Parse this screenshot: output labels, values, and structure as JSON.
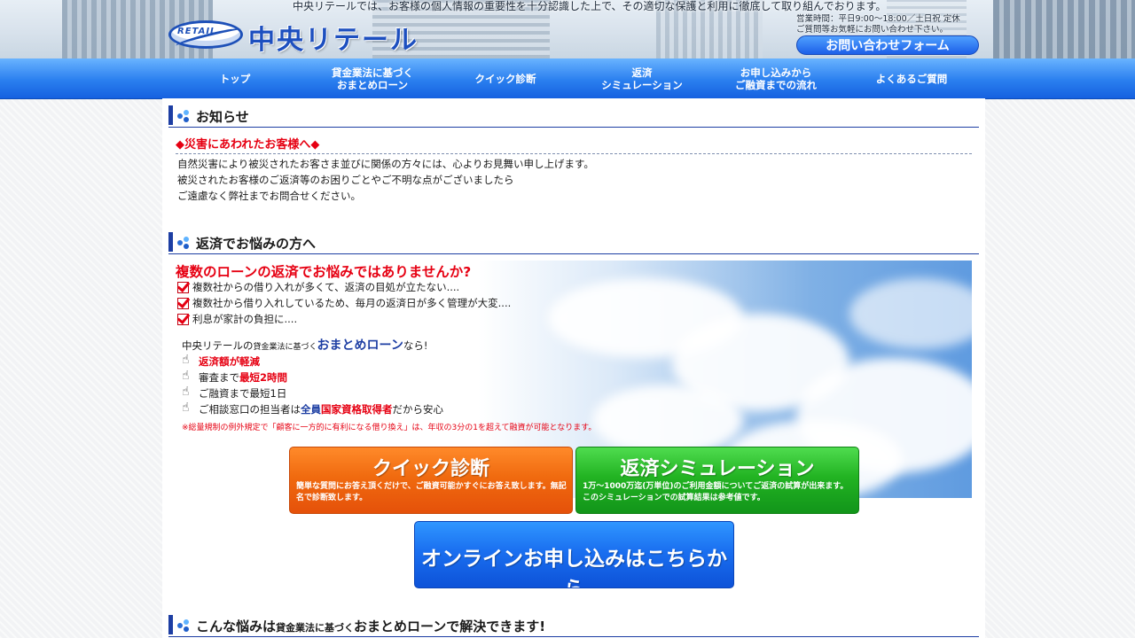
{
  "header": {
    "tagline": "中央リテールでは、お客様の個人情報の重要性を十分認識した上で、その適切な保護と利用に徹底して取り組んでおります。",
    "logo_text": "RETAIL",
    "brand_name": "中央リテール",
    "hours_line1": "営業時間：平日9:00〜18:00／土日祝 定休",
    "hours_line2": "ご質問等お気軽にお問い合わせ下さい。",
    "contact_button": "お問い合わせフォーム"
  },
  "nav": {
    "items": [
      {
        "label": "トップ"
      },
      {
        "label": "貸金業法に基づく\nおまとめローン"
      },
      {
        "label": "クイック診断"
      },
      {
        "label": "返済\nシミュレーション"
      },
      {
        "label": "お申し込みから\nご融資までの流れ"
      },
      {
        "label": "よくあるご質問"
      }
    ]
  },
  "news": {
    "heading": "お知らせ",
    "notice_title": "◆災害にあわれたお客様へ◆",
    "lines": [
      "自然災害により被災されたお客さま並びに関係の方々には、心よりお見舞い申し上げます。",
      "被災されたお客様のご返済等のお困りごとやご不明な点がございましたら",
      "ご遠慮なく弊社までお問合せください。"
    ]
  },
  "worry": {
    "heading": "返済でお悩みの方へ",
    "headline": "複数のローンの返済でお悩みではありませんか?",
    "checks": [
      "複数社からの借り入れが多くて、返済の目処が立たない....",
      "複数社から借り入れしているため、毎月の返済日が多く管理が大変....",
      "利息が家計の負担に...."
    ],
    "intro_prefix": "中央リテールの",
    "intro_small": "貸金業法に基づく",
    "intro_big": "おまとめローン",
    "intro_suffix": "なら!",
    "point1": "返済額が軽減",
    "point2_prefix": "審査まで",
    "point2_red": "最短2時間",
    "point3": "ご融資まで最短1日",
    "point4_prefix": "ご相談窓口の担当者は",
    "point4_blue": "全員",
    "point4_red": "国家資格取得者",
    "point4_suffix": "だから安心",
    "footnote": "※総量規制の例外規定で「顧客に一方的に有利になる借り換え」は、年収の3分の1を超えて融資が可能となります。"
  },
  "cta": {
    "quick_title": "クイック診断",
    "quick_desc": "簡単な質問にお答え頂くだけで、ご融資可能かすぐにお答え致します。無記名で診断致します。",
    "sim_title": "返済シミュレーション",
    "sim_desc": "1万〜1000万迄(万単位)のご利用金額についてご返済の試算が出来ます。このシミュレーションでの試算結果は参考値です。",
    "apply_title": "オンラインお申し込みはこちらから"
  },
  "section3": {
    "heading_prefix": "こんな悩みは",
    "heading_small": "貸金業法に基づく",
    "heading_suffix": "おまとめローンで解決できます!"
  },
  "colors": {
    "nav_blue": "#2a7fef",
    "accent_red": "#e60012",
    "heading_navy": "#1d3ea3",
    "cta_orange": "#f06a0f",
    "cta_green": "#22b322",
    "cta_blue": "#1a6ff0"
  }
}
